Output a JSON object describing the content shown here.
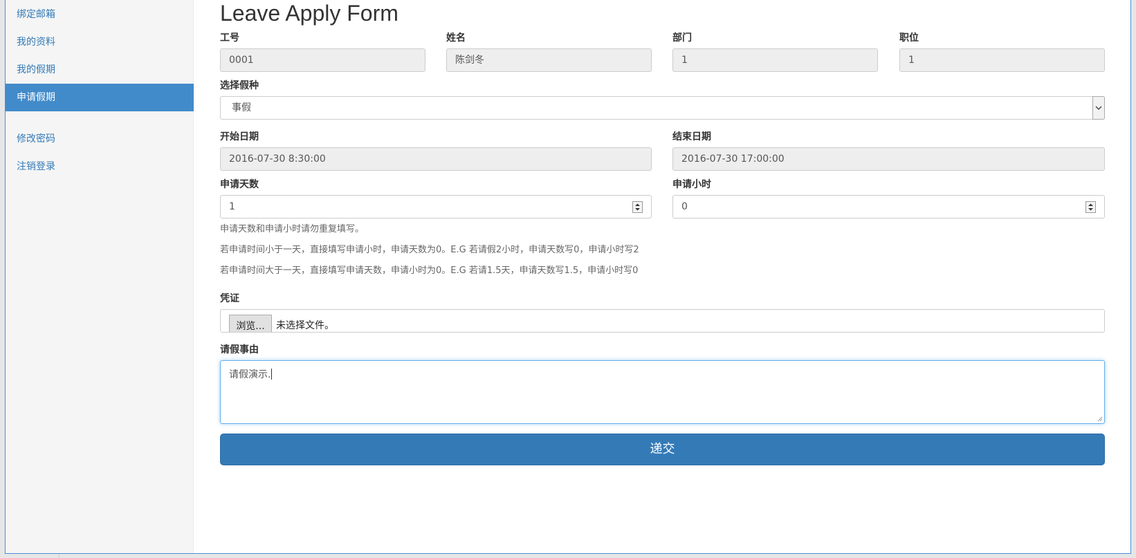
{
  "sidebar": {
    "items": [
      {
        "label": "绑定邮箱",
        "active": false
      },
      {
        "label": "我的资料",
        "active": false
      },
      {
        "label": "我的假期",
        "active": false
      },
      {
        "label": "申请假期",
        "active": true
      },
      {
        "label": "修改密码",
        "active": false
      },
      {
        "label": "注销登录",
        "active": false
      }
    ]
  },
  "form": {
    "title": "Leave Apply Form",
    "employee_id": {
      "label": "工号",
      "value": "0001"
    },
    "name": {
      "label": "姓名",
      "value": "陈剑冬"
    },
    "department": {
      "label": "部门",
      "value": "1"
    },
    "position": {
      "label": "职位",
      "value": "1"
    },
    "leave_type": {
      "label": "选择假种",
      "value": "事假"
    },
    "start_date": {
      "label": "开始日期",
      "value": "2016-07-30 8:30:00"
    },
    "end_date": {
      "label": "结束日期",
      "value": "2016-07-30 17:00:00"
    },
    "days": {
      "label": "申请天数",
      "value": "1"
    },
    "hours": {
      "label": "申请小时",
      "value": "0"
    },
    "hints": [
      "申请天数和申请小时请勿重复填写。",
      "若申请时间小于一天，直接填写申请小时，申请天数为0。E.G 若请假2小时，申请天数写0，申请小时写2",
      "若申请时间大于一天，直接填写申请天数，申请小时为0。E.G 若请1.5天，申请天数写1.5，申请小时写0"
    ],
    "voucher": {
      "label": "凭证",
      "button": "浏览...",
      "status": "未选择文件。"
    },
    "reason": {
      "label": "请假事由",
      "value": "请假演示."
    },
    "submit_label": "递交"
  },
  "colors": {
    "accent": "#428bca",
    "link": "#337ab7",
    "button": "#337ab7",
    "readonly_bg": "#eeeeee"
  }
}
